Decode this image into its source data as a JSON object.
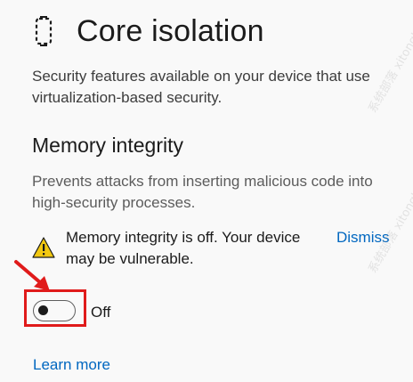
{
  "header": {
    "title": "Core isolation",
    "icon": "core-isolation-chip-icon"
  },
  "description": "Security features available on your device that use virtualization-based security.",
  "memory_integrity": {
    "title": "Memory integrity",
    "description": "Prevents attacks from inserting malicious code into high-security processes.",
    "warning": {
      "icon": "warning-icon",
      "text": "Memory integrity is off. Your device may be vulnerable.",
      "dismiss_label": "Dismiss"
    },
    "toggle": {
      "state": "off",
      "label": "Off"
    },
    "learn_more_label": "Learn more"
  },
  "annotation": {
    "arrow_color": "#e01b1b",
    "box_color": "#e01b1b"
  },
  "watermark": {
    "text_left": "系统部落 xitongbuluo.com",
    "text_right": "系统部落 xitongbuluo.com"
  },
  "colors": {
    "link": "#0067c0",
    "warning": "#f2c811",
    "background": "#f9f9f9"
  }
}
